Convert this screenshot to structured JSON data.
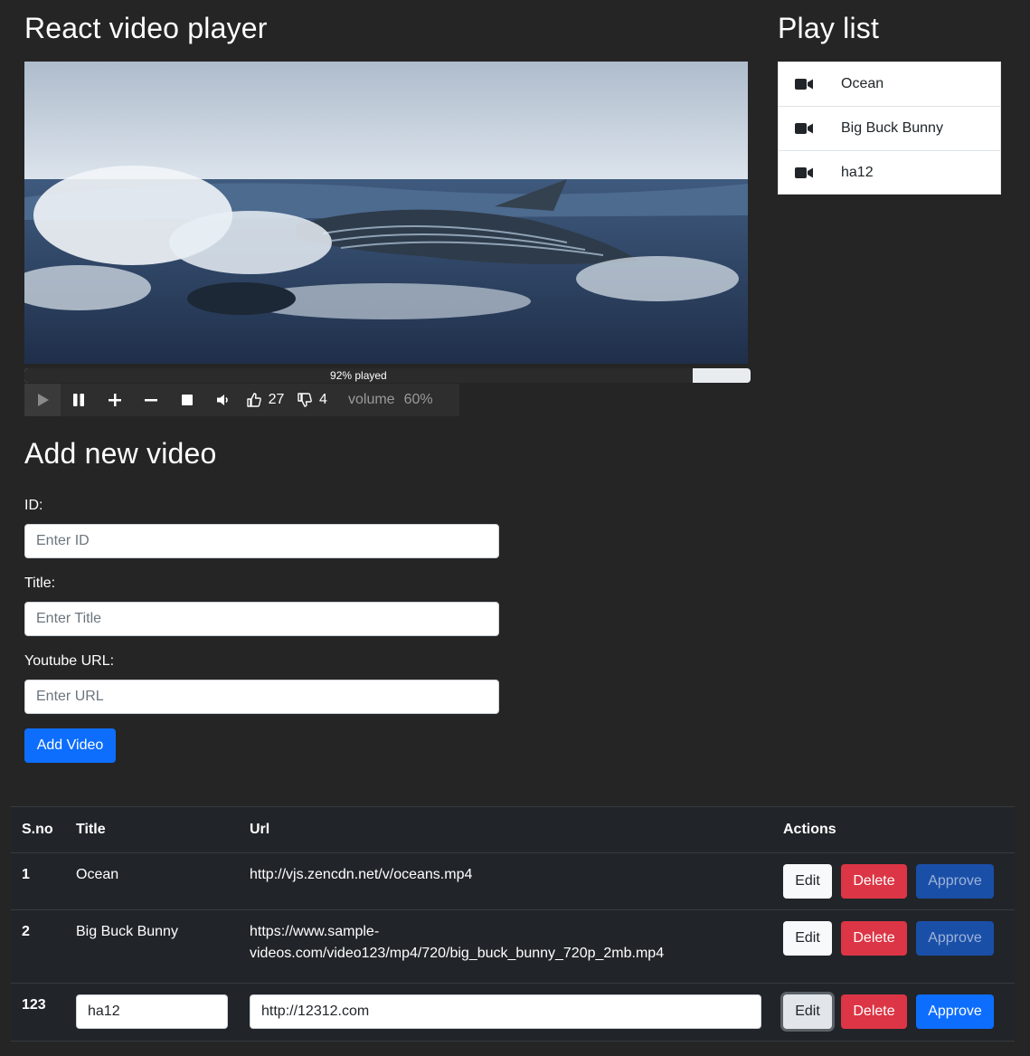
{
  "player": {
    "title": "React video player",
    "progress_label": "92% played",
    "progress_fraction": 0.92,
    "likes": "27",
    "dislikes": "4",
    "volume_label": "volume",
    "volume_value": "60%"
  },
  "playlist": {
    "title": "Play list",
    "items": [
      {
        "label": "Ocean",
        "icon": "video-camera-icon"
      },
      {
        "label": "Big Buck Bunny",
        "icon": "video-camera-icon"
      },
      {
        "label": "ha12",
        "icon": "video-camera-icon"
      }
    ]
  },
  "form": {
    "title": "Add new video",
    "id_label": "ID:",
    "id_placeholder": "Enter ID",
    "title_label": "Title:",
    "title_placeholder": "Enter Title",
    "url_label": "Youtube URL:",
    "url_placeholder": "Enter URL",
    "submit_label": "Add Video"
  },
  "table": {
    "headers": [
      "S.no",
      "Title",
      "Url",
      "Actions"
    ],
    "rows": [
      {
        "sno": "1",
        "title": "Ocean",
        "url": "http://vjs.zencdn.net/v/oceans.mp4"
      },
      {
        "sno": "2",
        "title": "Big Buck Bunny",
        "url_line1": "https://www.sample-",
        "url_line2": "videos.com/video123/mp4/720/big_buck_bunny_720p_2mb.mp4"
      },
      {
        "sno": "123",
        "title_value": "ha12",
        "url_value": "http://12312.com"
      }
    ],
    "edit_label": "Edit",
    "delete_label": "Delete",
    "approve_label": "Approve"
  },
  "colors": {
    "background": "#252525",
    "primary": "#0d6efd",
    "danger": "#dc3545",
    "table_bg": "#212529"
  }
}
